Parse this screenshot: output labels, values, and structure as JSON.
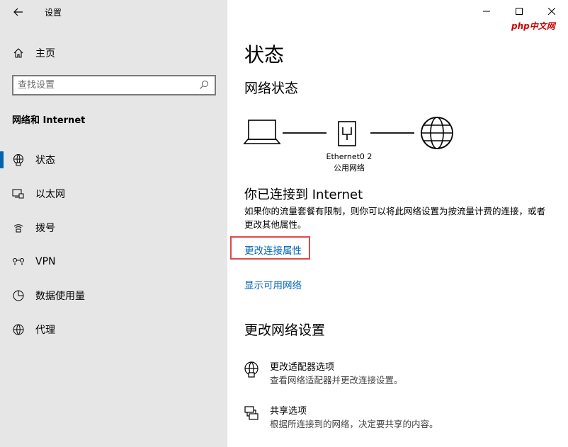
{
  "window": {
    "title": "设置",
    "watermark": "php中文网"
  },
  "sidebar": {
    "home_label": "主页",
    "search_placeholder": "查找设置",
    "section_title": "网络和 Internet",
    "items": [
      {
        "label": "状态",
        "icon": "network-status-icon",
        "active": true
      },
      {
        "label": "以太网",
        "icon": "ethernet-icon",
        "active": false
      },
      {
        "label": "拨号",
        "icon": "dialup-icon",
        "active": false
      },
      {
        "label": "VPN",
        "icon": "vpn-icon",
        "active": false
      },
      {
        "label": "数据使用量",
        "icon": "data-usage-icon",
        "active": false
      },
      {
        "label": "代理",
        "icon": "globe-icon",
        "active": false
      }
    ]
  },
  "main": {
    "page_title": "状态",
    "network_status_title": "网络状态",
    "adapter": {
      "name": "Ethernet0 2",
      "type": "公用网络"
    },
    "connected_title": "你已连接到 Internet",
    "connected_desc": "如果你的流量套餐有限制，则你可以将此网络设置为按流量计费的连接，或者更改其他属性。",
    "link_change_properties": "更改连接属性",
    "link_show_networks": "显示可用网络",
    "change_settings_title": "更改网络设置",
    "options": [
      {
        "title": "更改适配器选项",
        "desc": "查看网络适配器并更改连接设置。",
        "icon": "adapter-icon"
      },
      {
        "title": "共享选项",
        "desc": "根据所连接到的网络，决定要共享的内容。",
        "icon": "sharing-icon"
      }
    ],
    "highlight_color": "#e04848",
    "accent_color": "#0063b1"
  }
}
